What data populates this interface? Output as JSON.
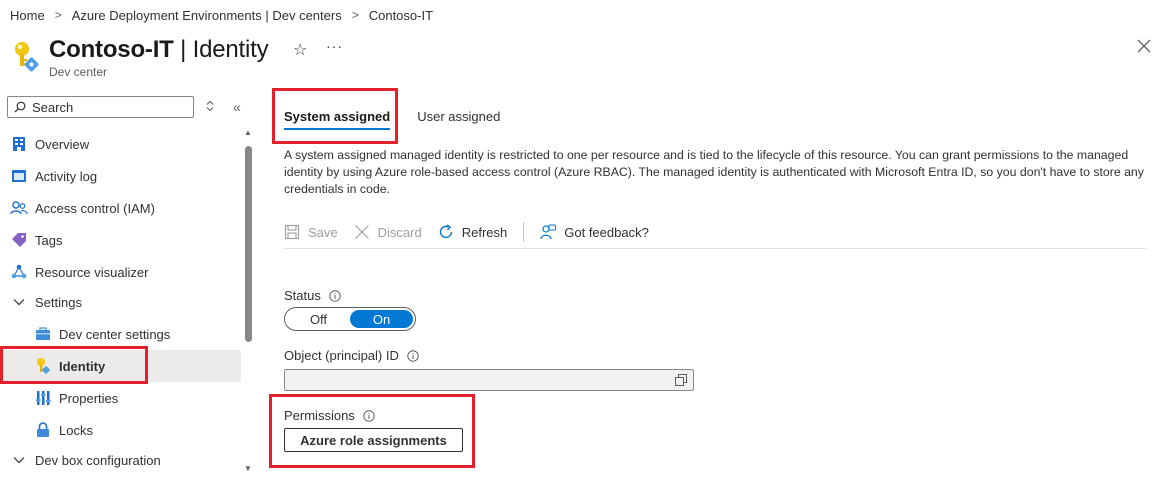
{
  "breadcrumb": {
    "items": [
      "Home",
      "Azure Deployment Environments | Dev centers",
      "Contoso-IT"
    ],
    "separator": ">"
  },
  "header": {
    "title_resource": "Contoso-IT",
    "title_separator": " | ",
    "title_page": "Identity",
    "subtitle": "Dev center",
    "favorite_glyph": "☆",
    "more_glyph": "···",
    "icon": "key-identity-icon"
  },
  "sidebar": {
    "search_placeholder": "Search",
    "collapse_glyph": "«",
    "items": [
      {
        "label": "Overview",
        "icon": "overview-icon"
      },
      {
        "label": "Activity log",
        "icon": "activity-log-icon"
      },
      {
        "label": "Access control (IAM)",
        "icon": "people-icon"
      },
      {
        "label": "Tags",
        "icon": "tag-icon"
      },
      {
        "label": "Resource visualizer",
        "icon": "visualizer-icon"
      },
      {
        "label": "Settings",
        "icon": "chevron-down-icon"
      },
      {
        "label": "Dev center settings",
        "icon": "briefcase-icon"
      },
      {
        "label": "Identity",
        "icon": "key-identity-icon"
      },
      {
        "label": "Properties",
        "icon": "properties-icon"
      },
      {
        "label": "Locks",
        "icon": "lock-icon"
      },
      {
        "label": "Dev box configuration",
        "icon": "chevron-down-icon"
      }
    ]
  },
  "main": {
    "tabs": [
      {
        "label": "System assigned",
        "active": true
      },
      {
        "label": "User assigned",
        "active": false
      }
    ],
    "description": "A system assigned managed identity is restricted to one per resource and is tied to the lifecycle of this resource. You can grant permissions to the managed identity by using Azure role-based access control (Azure RBAC). The managed identity is authenticated with Microsoft Entra ID, so you don't have to store any credentials in code.",
    "toolbar": {
      "save_label": "Save",
      "discard_label": "Discard",
      "refresh_label": "Refresh",
      "feedback_label": "Got feedback?"
    },
    "status": {
      "label": "Status",
      "off_label": "Off",
      "on_label": "On",
      "value": "On"
    },
    "object_id": {
      "label": "Object (principal) ID",
      "value": ""
    },
    "permissions": {
      "label": "Permissions",
      "button_label": "Azure role assignments"
    }
  },
  "colors": {
    "accent": "#0078d4",
    "highlight": "#e3202b",
    "selected_nav": "#edebe9"
  }
}
